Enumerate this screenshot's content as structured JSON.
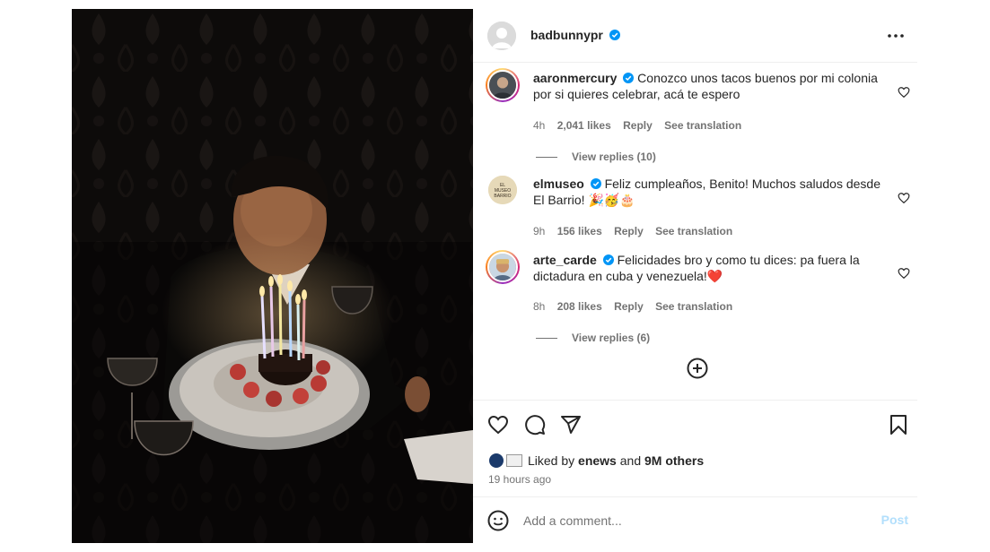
{
  "post": {
    "username": "badbunnypr",
    "more_label": "..."
  },
  "comments": [
    {
      "username": "aaronmercury",
      "text": "Conozco unos tacos buenos por mi colonia por si quieres celebrar, acá te espero",
      "time": "4h",
      "likes": "2,041 likes",
      "reply": "Reply",
      "translate": "See translation",
      "view_replies": "View replies (10)"
    },
    {
      "username": "elmuseo",
      "text": "Feliz cumpleaños, Benito! Muchos saludos desde El Barrio! 🎉🥳🎂",
      "time": "9h",
      "likes": "156 likes",
      "reply": "Reply",
      "translate": "See translation",
      "avatar_text": "EL MUSEO DEL BARRIO"
    },
    {
      "username": "arte_carde",
      "text": "Felicidades bro y como tu dices: pa fuera la dictadura en cuba y venezuela!❤️",
      "time": "8h",
      "likes": "208 likes",
      "reply": "Reply",
      "translate": "See translation",
      "view_replies": "View replies (6)"
    }
  ],
  "likes_line": {
    "prefix": "Liked by",
    "user": "enews",
    "middle": "and",
    "others": "9M others"
  },
  "timestamp": "19 hours ago",
  "add_comment": {
    "placeholder": "Add a comment...",
    "post_label": "Post"
  },
  "colors": {
    "verified": "#0095f6",
    "post_disabled": "#b2dffc",
    "muted": "#737373"
  }
}
